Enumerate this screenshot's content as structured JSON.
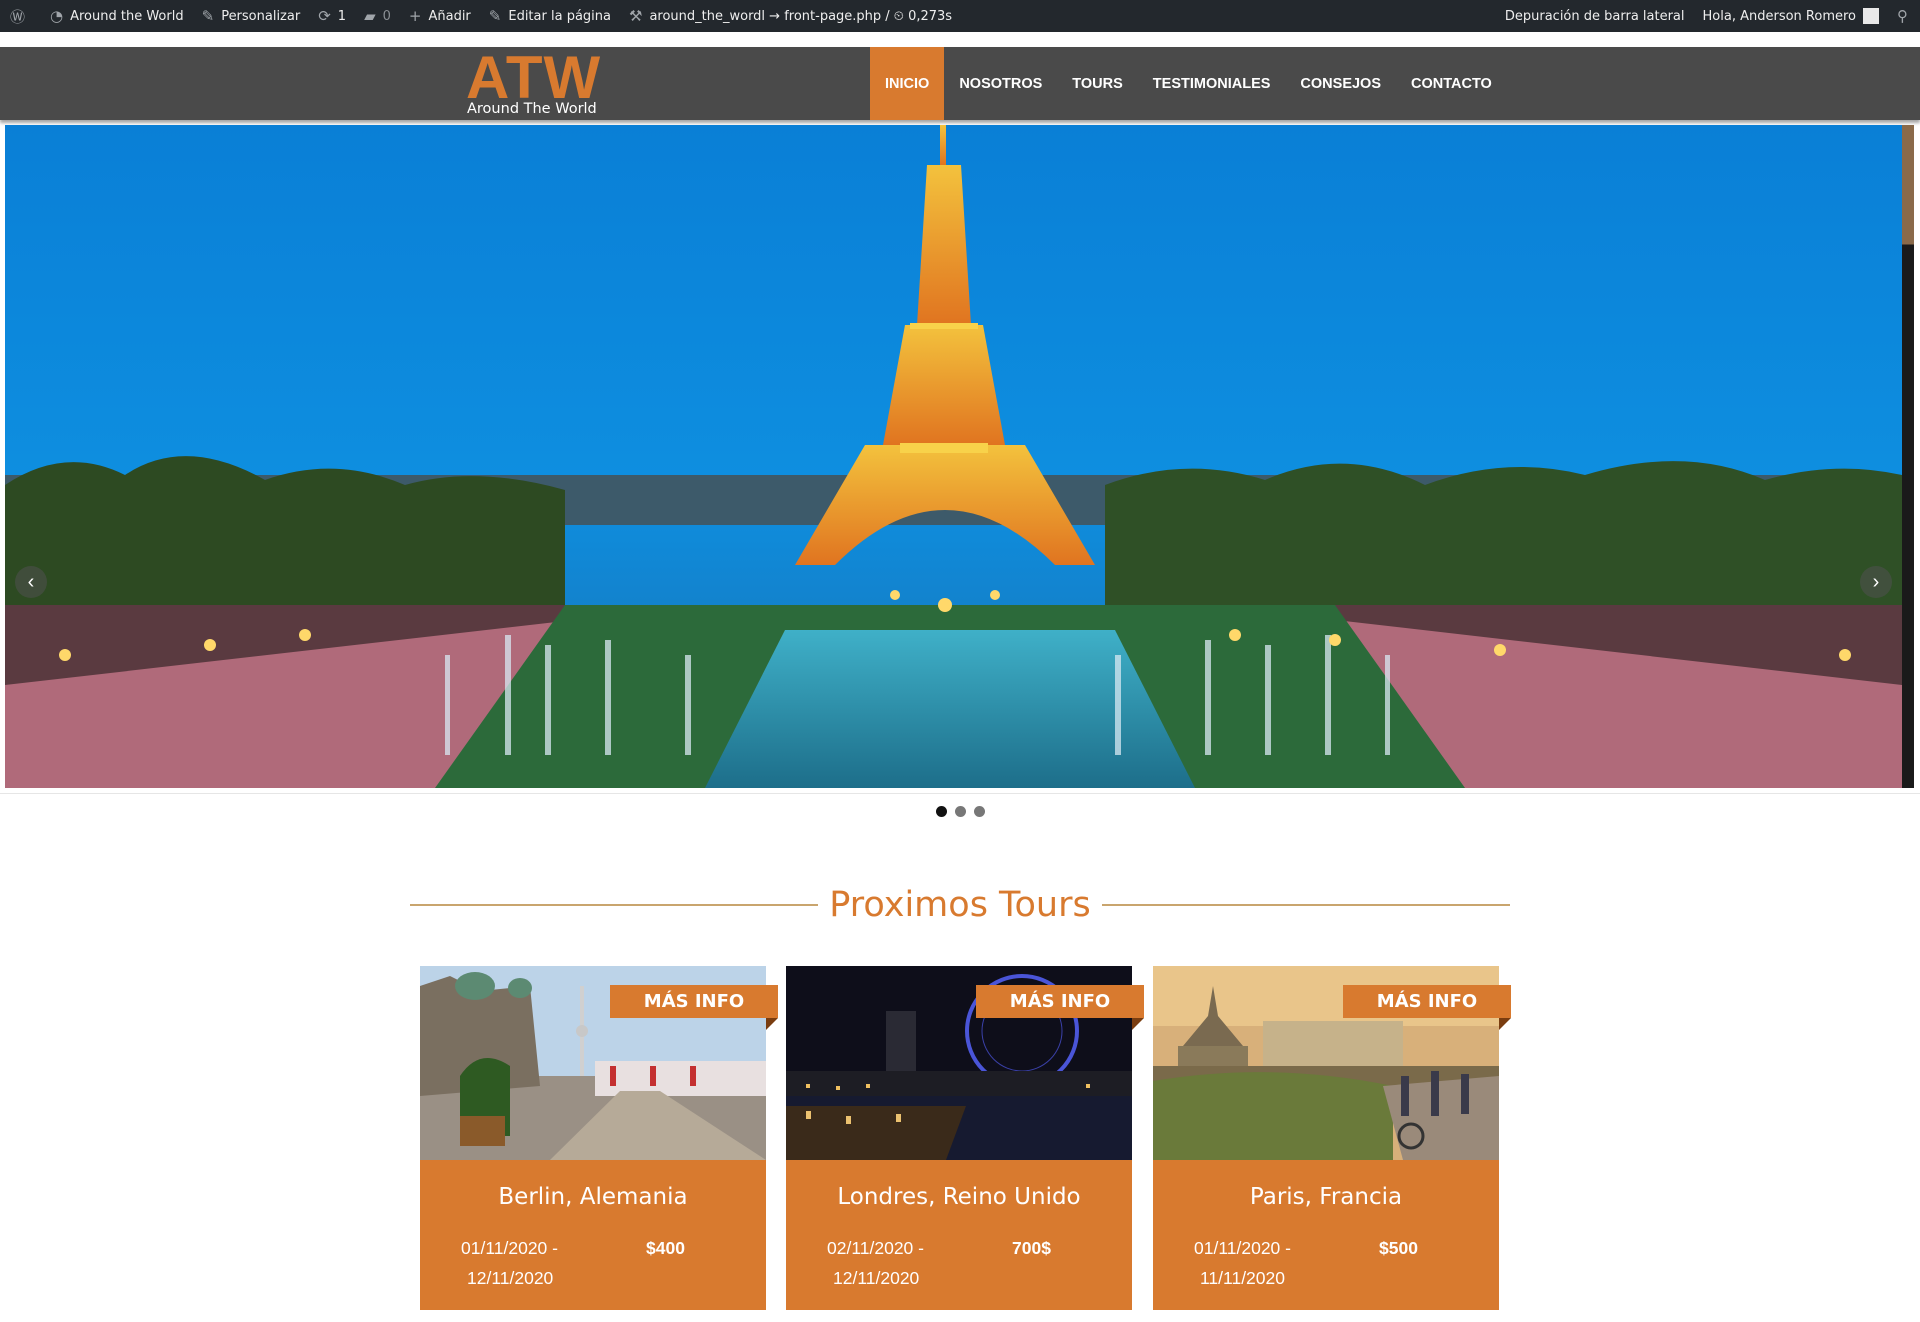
{
  "admin_bar": {
    "wp_logo_icon": "wordpress-icon",
    "site_name": "Around the World",
    "customize": "Personalizar",
    "updates_count": "1",
    "comments_count": "0",
    "new": "Añadir",
    "edit_page": "Editar la página",
    "template_info": "around_the_wordl → front-page.php / ⏲ 0,273s",
    "debug_sidebar": "Depuración de barra lateral",
    "greeting": "Hola, Anderson Romero"
  },
  "header": {
    "logo_text": "ATW",
    "logo_tagline": "Around The World",
    "nav": [
      {
        "label": "INICIO",
        "active": true
      },
      {
        "label": "NOSOTROS",
        "active": false
      },
      {
        "label": "TOURS",
        "active": false
      },
      {
        "label": "TESTIMONIALES",
        "active": false
      },
      {
        "label": "CONSEJOS",
        "active": false
      },
      {
        "label": "CONTACTO",
        "active": false
      }
    ]
  },
  "slider": {
    "slide_count": 3,
    "active_slide": 1,
    "prev_icon": "chevron-left-icon",
    "next_icon": "chevron-right-icon"
  },
  "section_title": "Proximos Tours",
  "tours": [
    {
      "title": "Berlin, Alemania",
      "date_start": "01/11/2020 -",
      "date_end": "12/11/2020",
      "price": "$400",
      "more": "MÁS INFO"
    },
    {
      "title": "Londres, Reino Unido",
      "date_start": "02/11/2020 -",
      "date_end": "12/11/2020",
      "price": "700$",
      "more": "MÁS INFO"
    },
    {
      "title": "Paris, Francia",
      "date_start": "01/11/2020 -",
      "date_end": "11/11/2020",
      "price": "$500",
      "more": "MÁS INFO"
    }
  ],
  "colors": {
    "accent": "#d87a2f",
    "header_bg": "#4a4a4a",
    "admin_bar_bg": "#23282d",
    "section_line": "#c9a56e"
  }
}
